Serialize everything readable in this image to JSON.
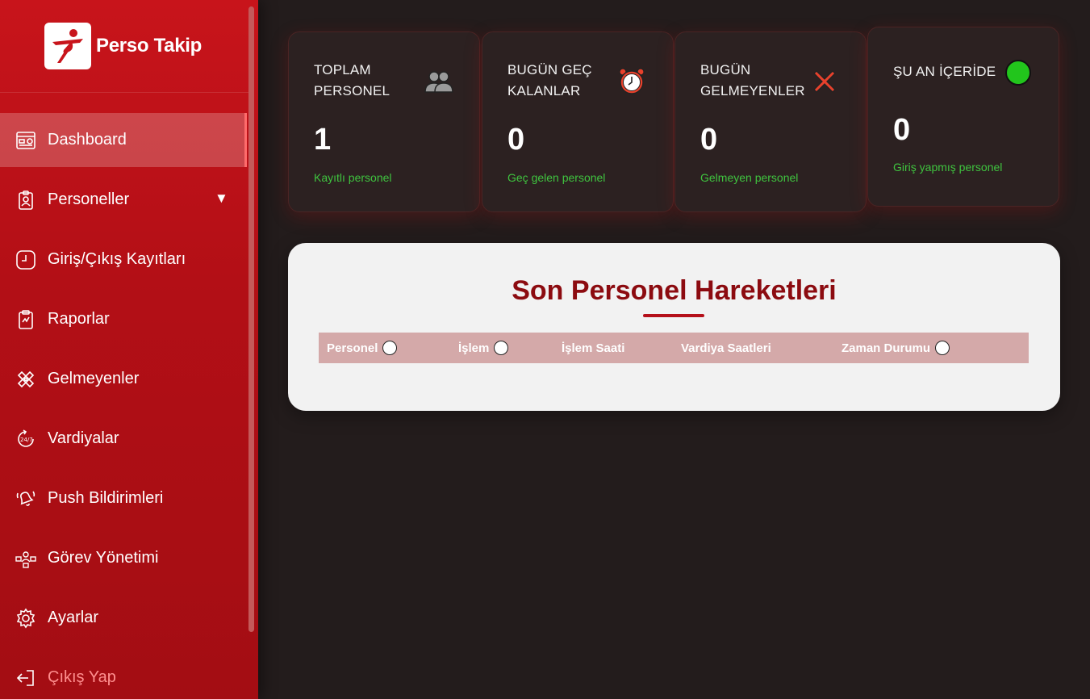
{
  "app": {
    "name": "Perso Takip"
  },
  "sidebar": {
    "items": [
      {
        "label": "Dashboard",
        "icon": "dashboard-icon",
        "active": true
      },
      {
        "label": "Personeller",
        "icon": "id-badge-icon",
        "has_submenu": true,
        "caret": "▼"
      },
      {
        "label": "Giriş/Çıkış Kayıtları",
        "icon": "clock-icon"
      },
      {
        "label": "Raporlar",
        "icon": "clipboard-icon"
      },
      {
        "label": "Gelmeyenler",
        "icon": "cross-bandage-icon"
      },
      {
        "label": "Vardiyalar",
        "icon": "24-7-icon"
      },
      {
        "label": "Push Bildirimleri",
        "icon": "bell-icon"
      },
      {
        "label": "Görev Yönetimi",
        "icon": "task-management-icon"
      },
      {
        "label": "Ayarlar",
        "icon": "gear-icon"
      },
      {
        "label": "Çıkış Yap",
        "icon": "logout-icon"
      }
    ]
  },
  "cards": [
    {
      "title": "TOPLAM PERSONEL",
      "value": "1",
      "subtitle": "Kayıtlı personel",
      "icon": "people-icon"
    },
    {
      "title": "BUGÜN GEÇ KALANLAR",
      "value": "0",
      "subtitle": "Geç gelen personel",
      "icon": "alarm-clock-icon"
    },
    {
      "title": "BUGÜN GELMEYENLER",
      "value": "0",
      "subtitle": "Gelmeyen personel",
      "icon": "red-x-icon"
    },
    {
      "title": "ŞU AN İÇERİDE",
      "value": "0",
      "subtitle": "Giriş yapmış personel",
      "icon": "green-circle-icon"
    }
  ],
  "panel": {
    "title": "Son Personel Hareketleri",
    "columns": [
      {
        "label": "Personel",
        "sortable": true
      },
      {
        "label": "İşlem",
        "sortable": true
      },
      {
        "label": "İşlem Saati",
        "sortable": false
      },
      {
        "label": "Vardiya Saatleri",
        "sortable": false
      },
      {
        "label": "Zaman Durumu",
        "sortable": true
      }
    ],
    "rows": []
  },
  "colors": {
    "sidebar": "#c8141b",
    "background": "#231c1c",
    "accent_green": "#3fc43f",
    "panel_title": "#8c0b10",
    "table_header": "#d4a9a9"
  }
}
